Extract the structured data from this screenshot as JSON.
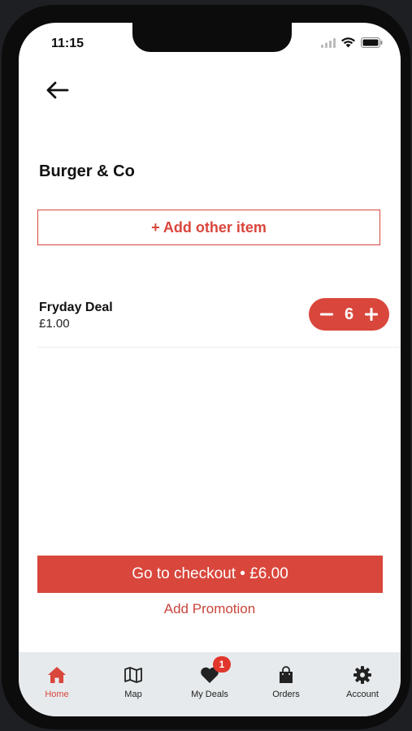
{
  "status_bar": {
    "time": "11:15",
    "icons": [
      "signal-icon",
      "wifi-icon",
      "battery-icon"
    ]
  },
  "header": {
    "back_icon": "arrow-left-icon"
  },
  "store": {
    "name": "Burger & Co"
  },
  "add_item": {
    "label": "+ Add other item"
  },
  "cart": {
    "items": [
      {
        "name": "Fryday Deal",
        "price": "£1.00",
        "quantity": "6"
      }
    ]
  },
  "checkout": {
    "label": "Go to checkout • £6.00"
  },
  "promotion": {
    "label": "Add Promotion"
  },
  "tabs": [
    {
      "label": "Home",
      "icon": "home-icon",
      "active": true
    },
    {
      "label": "Map",
      "icon": "map-icon"
    },
    {
      "label": "My Deals",
      "icon": "heart-icon",
      "badge": "1"
    },
    {
      "label": "Orders",
      "icon": "shopping-bag-icon"
    },
    {
      "label": "Account",
      "icon": "gear-icon"
    }
  ],
  "colors": {
    "accent": "#d9463c",
    "tabbar_bg": "#e6eaec",
    "badge": "#e2362d"
  }
}
